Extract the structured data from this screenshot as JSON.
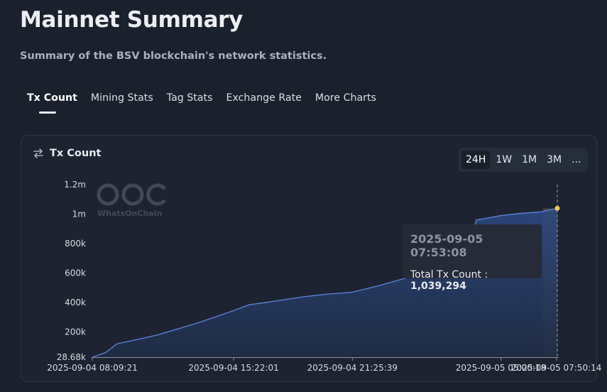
{
  "header": {
    "title": "Mainnet Summary",
    "subtitle": "Summary of the BSV blockchain's network statistics."
  },
  "tabs": [
    {
      "label": "Tx Count",
      "active": true
    },
    {
      "label": "Mining Stats",
      "active": false
    },
    {
      "label": "Tag Stats",
      "active": false
    },
    {
      "label": "Exchange Rate",
      "active": false
    },
    {
      "label": "More Charts",
      "active": false
    }
  ],
  "card": {
    "title": "Tx Count",
    "icon": "swap-arrows-icon",
    "ranges": [
      {
        "label": "24H",
        "active": true
      },
      {
        "label": "1W",
        "active": false
      },
      {
        "label": "1M",
        "active": false
      },
      {
        "label": "3M",
        "active": false
      },
      {
        "label": "...",
        "active": false
      }
    ]
  },
  "watermark": {
    "text": "WhatsOnChain"
  },
  "tooltip": {
    "time": "2025-09-05 07:53:08",
    "label": "Total Tx Count : ",
    "value": "1,039,294"
  },
  "colors": {
    "line": "#5b7fd6",
    "area_top": "#2e4a86",
    "highlight": "#f2c94c"
  },
  "chart_data": {
    "type": "area",
    "title": "Tx Count",
    "xlabel": "",
    "ylabel": "",
    "y_ticks": [
      28680,
      200000,
      400000,
      600000,
      800000,
      1000000,
      1200000
    ],
    "y_tick_labels": [
      "28.68k",
      "200k",
      "400k",
      "600k",
      "800k",
      "1m",
      "1.2m"
    ],
    "ylim": [
      28680,
      1200000
    ],
    "x_tick_labels": [
      "2025-09-04 08:09:21",
      "2025-09-04 15:22:01",
      "2025-09-04 21:25:39",
      "2025-09-05 05:00:18",
      "2025-09-05 07:50:14"
    ],
    "grid": false,
    "series": [
      {
        "name": "Total Tx Count",
        "points": [
          {
            "t": "2025-09-04 08:09:21",
            "value": 28680
          },
          {
            "t": "2025-09-04 08:50:00",
            "value": 60000
          },
          {
            "t": "2025-09-04 09:25:00",
            "value": 120000
          },
          {
            "t": "2025-09-04 10:30:00",
            "value": 150000
          },
          {
            "t": "2025-09-04 11:30:00",
            "value": 180000
          },
          {
            "t": "2025-09-04 12:30:00",
            "value": 220000
          },
          {
            "t": "2025-09-04 13:30:00",
            "value": 260000
          },
          {
            "t": "2025-09-04 14:30:00",
            "value": 305000
          },
          {
            "t": "2025-09-04 15:22:01",
            "value": 345000
          },
          {
            "t": "2025-09-04 16:10:00",
            "value": 385000
          },
          {
            "t": "2025-09-04 17:00:00",
            "value": 400000
          },
          {
            "t": "2025-09-04 18:00:00",
            "value": 420000
          },
          {
            "t": "2025-09-04 19:00:00",
            "value": 440000
          },
          {
            "t": "2025-09-04 20:00:00",
            "value": 455000
          },
          {
            "t": "2025-09-04 21:25:39",
            "value": 470000
          },
          {
            "t": "2025-09-04 22:40:00",
            "value": 510000
          },
          {
            "t": "2025-09-05 00:00:00",
            "value": 560000
          },
          {
            "t": "2025-09-05 01:30:00",
            "value": 620000
          },
          {
            "t": "2025-09-05 02:40:00",
            "value": 680000
          },
          {
            "t": "2025-09-05 03:20:00",
            "value": 740000
          },
          {
            "t": "2025-09-05 03:45:00",
            "value": 960000
          },
          {
            "t": "2025-09-05 05:00:18",
            "value": 990000
          },
          {
            "t": "2025-09-05 06:00:00",
            "value": 1005000
          },
          {
            "t": "2025-09-05 07:00:00",
            "value": 1015000
          },
          {
            "t": "2025-09-05 07:45:00",
            "value": 1035000
          },
          {
            "t": "2025-09-05 07:53:08",
            "value": 1039294
          }
        ]
      }
    ],
    "highlight": {
      "t": "2025-09-05 07:53:08",
      "value": 1039294
    }
  }
}
